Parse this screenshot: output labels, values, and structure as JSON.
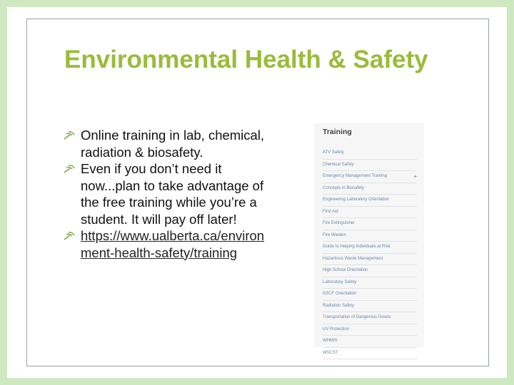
{
  "slide": {
    "title": "Environmental Health & Safety",
    "bullets": [
      {
        "text": "Online training in lab, chemical, radiation & biosafety.",
        "icon": "wifi-arrow-bullet-icon"
      },
      {
        "text": " Even if you don’t need it now...plan to take advantage of the free training while you’re a student. It will pay off later!",
        "icon": "wifi-arrow-bullet-icon"
      },
      {
        "text": "https://www.ualberta.ca/environment-health-safety/training",
        "icon": "wifi-arrow-bullet-icon",
        "link": true
      }
    ]
  },
  "training_panel": {
    "title": "Training",
    "items": [
      "ATV Safety",
      "Chemical Safety",
      "Emergency Management Training",
      "Concepts in Biosafety",
      "Engineering Laboratory Orientation",
      "First Aid",
      "Fire Extinguisher",
      "Fire Warden",
      "Guide to Helping Individuals at Risk",
      "Hazardous Waste Management",
      "High School Orientation",
      "Laboratory Safety",
      "NSCF Orientation",
      "Radiation Safety",
      "Transportation of Dangerous Goods",
      "UV Protection",
      "WHMIS",
      "WSCST"
    ],
    "expand_symbol": "+"
  },
  "colors": {
    "title": "#9bbb3a",
    "background_border": "#cfe8c2",
    "link_text": "#222222"
  }
}
